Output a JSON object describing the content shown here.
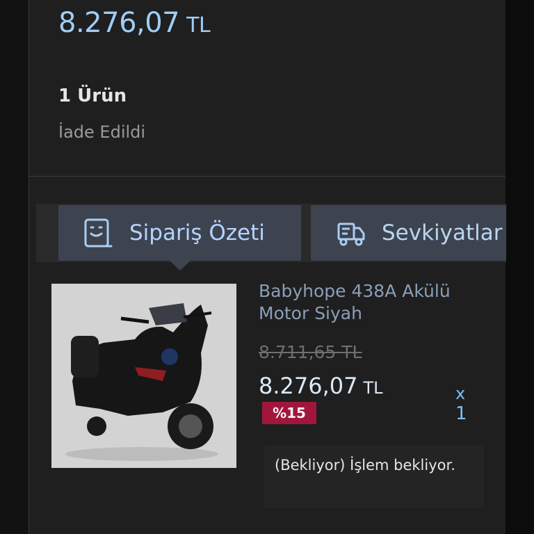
{
  "order": {
    "total_amount": "8.276,07",
    "currency": "TL",
    "item_count": "1 Ürün",
    "status": "İade Edildi"
  },
  "tabs": [
    {
      "label": "Sipariş Özeti",
      "icon": "order-summary-icon",
      "active": true
    },
    {
      "label": "Sevkiyatlar",
      "icon": "truck-icon",
      "active": false
    }
  ],
  "product": {
    "name": "Babyhope 438A Akülü Motor Siyah",
    "old_price": "8.711,65 TL",
    "price": "8.276,07",
    "currency": "TL",
    "discount": "%15",
    "qty_symbol": "x",
    "quantity": "1",
    "status_note": "(Bekliyor) İşlem bekliyor.",
    "image": "black-electric-motorcycle-photo"
  },
  "colors": {
    "accent": "#9fcdf6",
    "discount_badge": "#a3163b",
    "tab_background": "#3e4350"
  }
}
